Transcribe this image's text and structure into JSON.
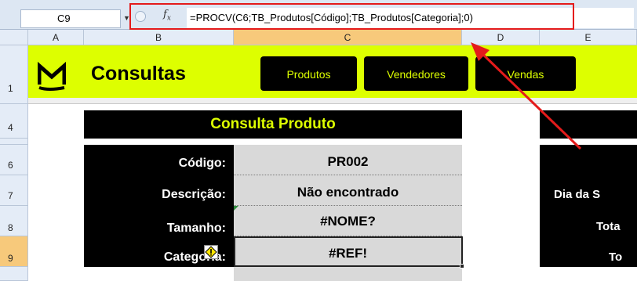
{
  "formula_bar": {
    "name_box": "C9",
    "fx_label": "f",
    "fx_sub": "x",
    "formula": "=PROCV(C6;TB_Produtos[Código];TB_Produtos[Categoria];0)"
  },
  "columns": [
    "A",
    "B",
    "C",
    "D",
    "E"
  ],
  "rows": [
    "1",
    "4",
    "6",
    "7",
    "8",
    "9"
  ],
  "header": {
    "title": "Consultas",
    "nav": [
      "Produtos",
      "Vendedores",
      "Vendas"
    ]
  },
  "consulta": {
    "title": "Consulta Produto",
    "fields": [
      {
        "label": "Código:",
        "value": "PR002"
      },
      {
        "label": "Descrição:",
        "value": "Não encontrado"
      },
      {
        "label": "Tamanho:",
        "value": "#NOME?"
      },
      {
        "label": "Categoria:",
        "value": "#REF!"
      }
    ]
  },
  "side_labels": [
    "Dia da S",
    "Tota",
    "To"
  ],
  "colors": {
    "accent": "#ddff00",
    "highlight_red": "#e41b1b",
    "selected_header": "#f7c97b"
  }
}
